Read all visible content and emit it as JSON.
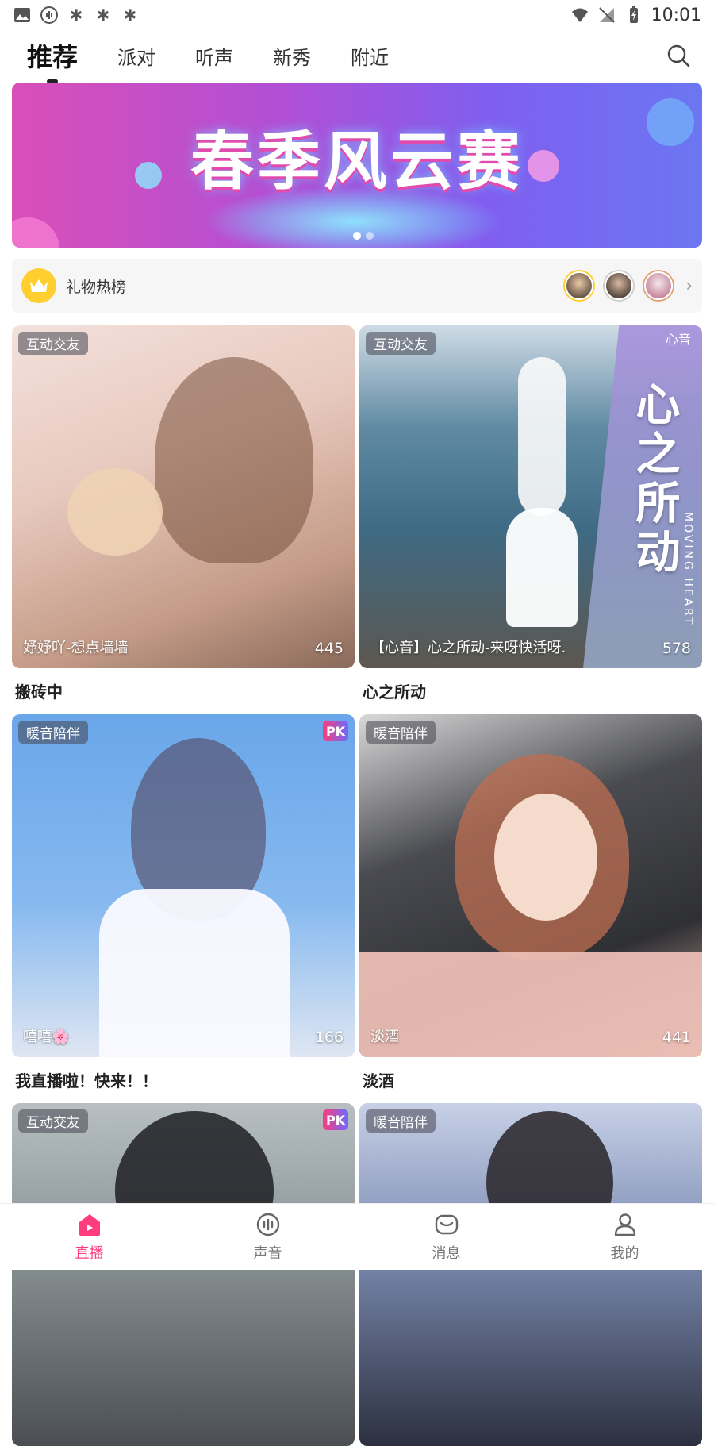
{
  "status_bar": {
    "time": "10:01",
    "notification_icons": [
      "image-icon",
      "voice-icon",
      "bug-icon",
      "bug-icon",
      "bug-icon"
    ]
  },
  "tabs": [
    {
      "label": "推荐",
      "active": true
    },
    {
      "label": "派对",
      "active": false
    },
    {
      "label": "听声",
      "active": false
    },
    {
      "label": "新秀",
      "active": false
    },
    {
      "label": "附近",
      "active": false
    }
  ],
  "banner": {
    "title": "春季风云赛",
    "slide_count": 2,
    "active_slide": 1
  },
  "gift_ranking": {
    "label": "礼物热榜"
  },
  "cards": [
    {
      "tag": "互动交友",
      "pk": false,
      "host": "妤妤吖-想点墙墙",
      "count": "445",
      "title": "搬砖中",
      "colors": [
        "#f0d4d1",
        "#c9a38f"
      ]
    },
    {
      "tag": "互动交友",
      "pk": false,
      "host": "【心音】心之所动-来呀快活呀.",
      "count": "578",
      "title": "心之所动",
      "colors": [
        "#6b93a8",
        "#a59bd6"
      ],
      "overlay_text": "心之所动",
      "overlay_sub": "MOVING HEART",
      "brand": "心音"
    },
    {
      "tag": "暖音陪伴",
      "pk": true,
      "pk_label": "PK",
      "host": "嘻嘻🌸",
      "count": "166",
      "title": "我直播啦！快来！！",
      "colors": [
        "#7fb4ea",
        "#e7eaf2"
      ]
    },
    {
      "tag": "暖音陪伴",
      "pk": false,
      "host": "淡酒",
      "count": "441",
      "title": "淡酒",
      "colors": [
        "#3b3c40",
        "#e7bfb4"
      ]
    },
    {
      "tag": "互动交友",
      "pk": true,
      "pk_label": "PK",
      "host": "",
      "count": "",
      "title": "",
      "colors": [
        "#9aa4a6",
        "#4a4e52"
      ]
    },
    {
      "tag": "暖音陪伴",
      "pk": false,
      "host": "",
      "count": "",
      "title": "",
      "colors": [
        "#8fa1c9",
        "#2c3040"
      ]
    }
  ],
  "bottom_nav": [
    {
      "label": "直播",
      "icon": "live-home-icon",
      "active": true
    },
    {
      "label": "声音",
      "icon": "voice-icon",
      "active": false
    },
    {
      "label": "消息",
      "icon": "message-icon",
      "active": false
    },
    {
      "label": "我的",
      "icon": "profile-icon",
      "active": false
    }
  ],
  "accent_color": "#ff3c7d"
}
